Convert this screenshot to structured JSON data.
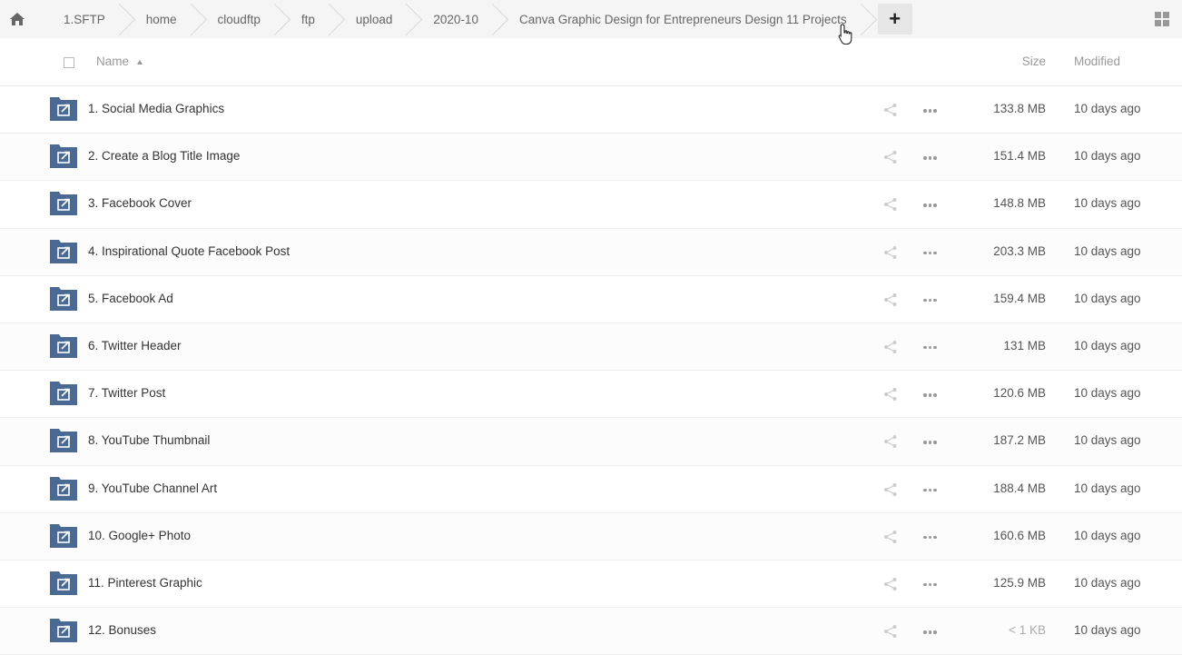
{
  "breadcrumb": {
    "items": [
      "1.SFTP",
      "home",
      "cloudftp",
      "ftp",
      "upload",
      "2020-10",
      "Canva Graphic Design for Entrepreneurs Design 11 Projects"
    ],
    "add_label": "+"
  },
  "table": {
    "headers": {
      "name": "Name",
      "size": "Size",
      "modified": "Modified"
    },
    "rows": [
      {
        "name": "1. Social Media Graphics",
        "size": "133.8 MB",
        "modified": "10 days ago"
      },
      {
        "name": "2. Create a Blog Title Image",
        "size": "151.4 MB",
        "modified": "10 days ago"
      },
      {
        "name": "3. Facebook Cover",
        "size": "148.8 MB",
        "modified": "10 days ago"
      },
      {
        "name": "4. Inspirational Quote Facebook Post",
        "size": "203.3 MB",
        "modified": "10 days ago"
      },
      {
        "name": "5. Facebook Ad",
        "size": "159.4 MB",
        "modified": "10 days ago"
      },
      {
        "name": "6. Twitter Header",
        "size": "131 MB",
        "modified": "10 days ago"
      },
      {
        "name": "7. Twitter Post",
        "size": "120.6 MB",
        "modified": "10 days ago"
      },
      {
        "name": "8. YouTube Thumbnail",
        "size": "187.2 MB",
        "modified": "10 days ago"
      },
      {
        "name": "9. YouTube Channel Art",
        "size": "188.4 MB",
        "modified": "10 days ago"
      },
      {
        "name": "10. Google+ Photo",
        "size": "160.6 MB",
        "modified": "10 days ago"
      },
      {
        "name": "11. Pinterest Graphic",
        "size": "125.9 MB",
        "modified": "10 days ago"
      },
      {
        "name": "12. Bonuses",
        "size": "< 1 KB",
        "modified": "10 days ago"
      }
    ]
  },
  "icons": {
    "home": "home-icon",
    "grid": "grid-view-icon",
    "folder": "shared-folder-icon",
    "share": "share-icon",
    "more": "more-dots-icon"
  },
  "colors": {
    "folder": "#4a6a94",
    "crumbbar": "#f5f5f5"
  }
}
